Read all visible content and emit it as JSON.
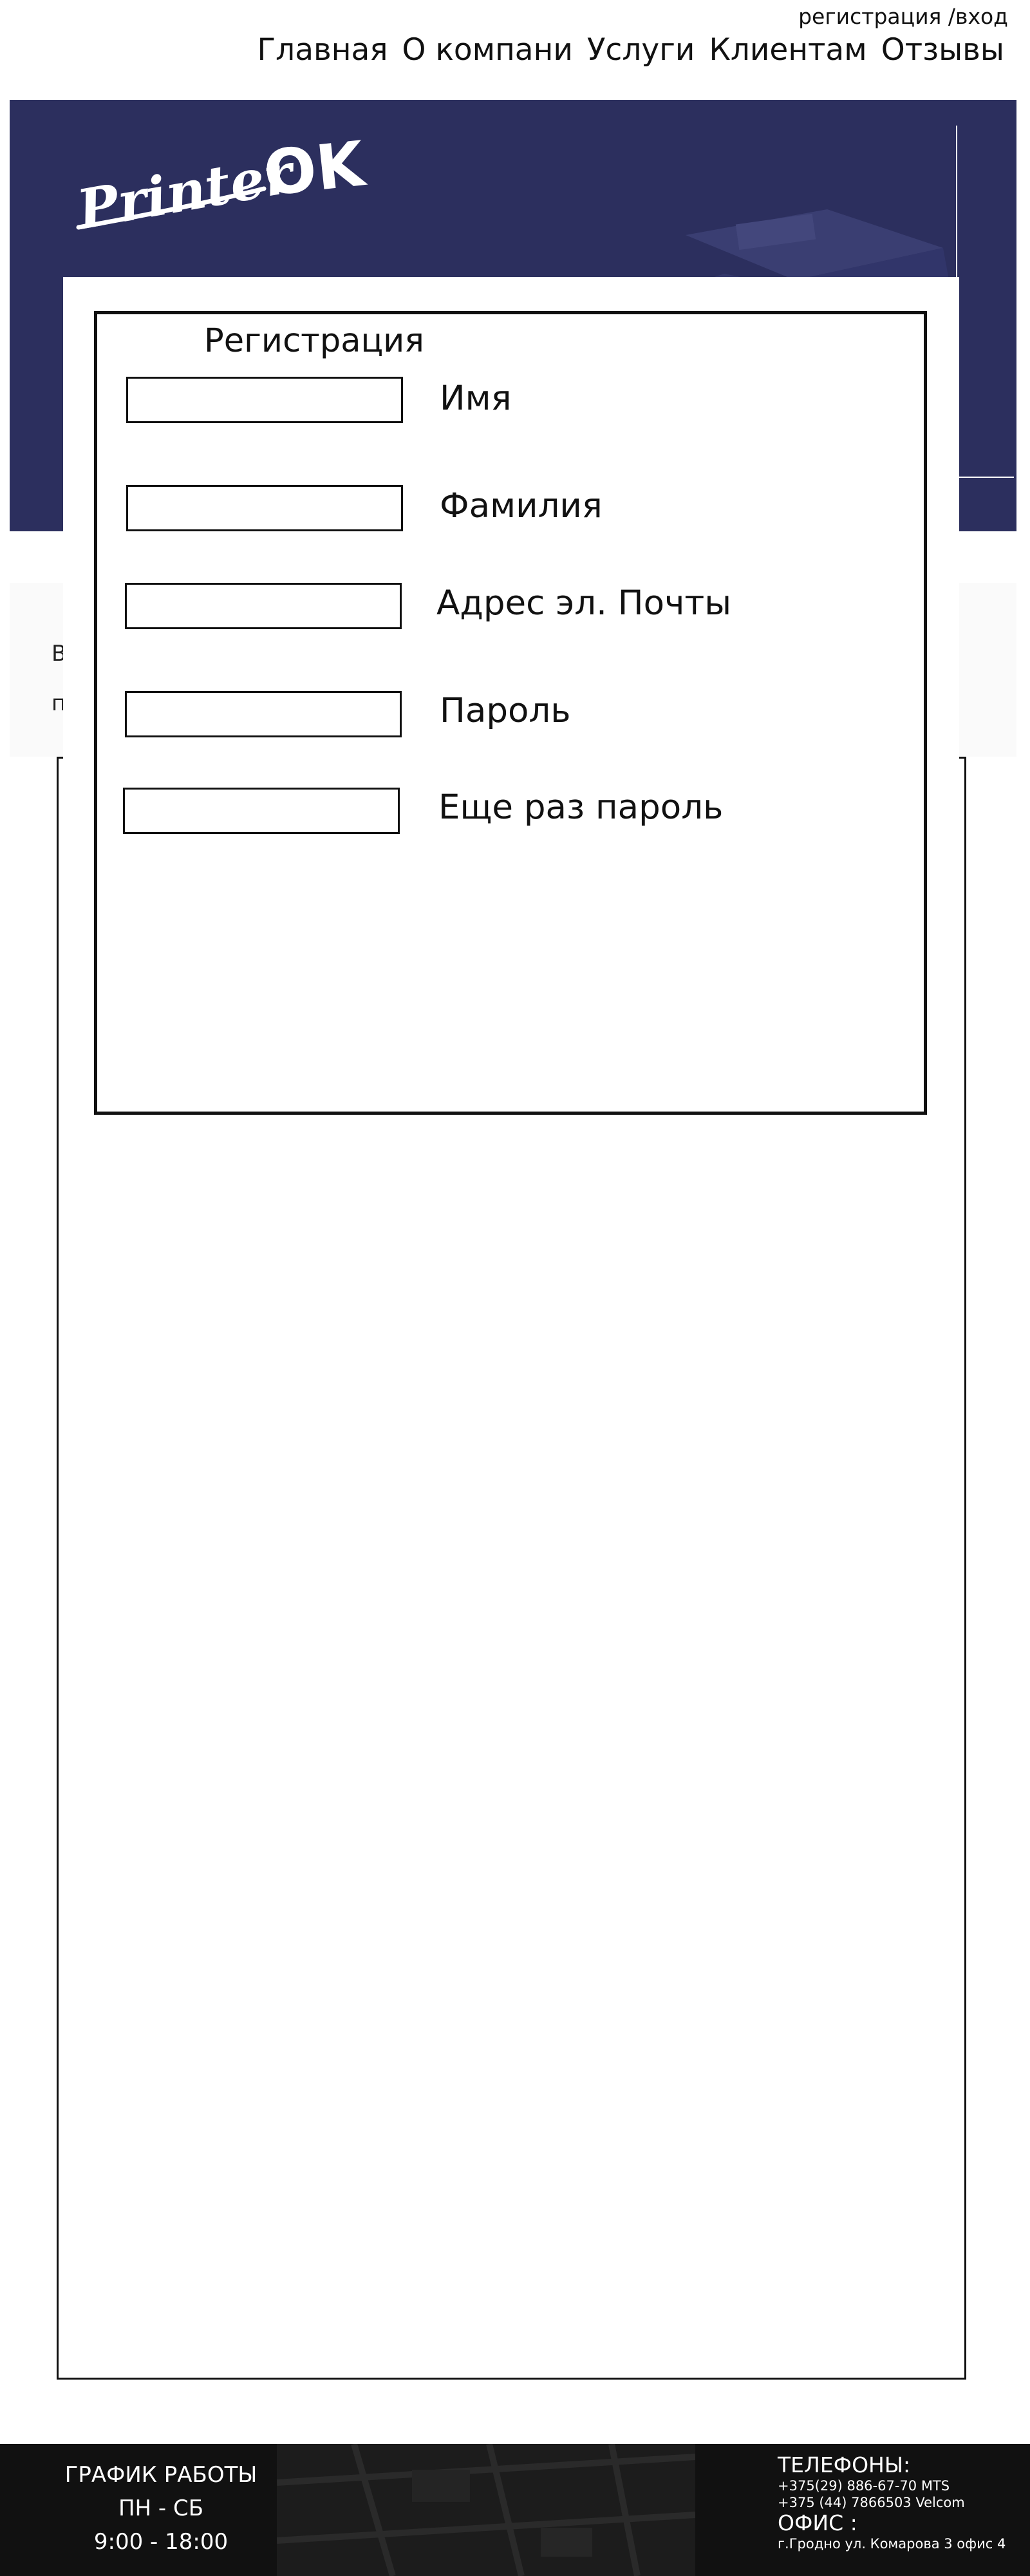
{
  "header": {
    "auth_link": "регистрация /вход",
    "nav": [
      "Главная",
      "О компани",
      "Услуги",
      "Клиентам",
      "Отзывы"
    ],
    "logo_text": "Printer",
    "logo_mark": "OK"
  },
  "content": {
    "stub_1": "В",
    "stub_2": "п"
  },
  "registration": {
    "title": "Регистрация",
    "fields": [
      {
        "label": "Имя",
        "value": ""
      },
      {
        "label": "Фамилия",
        "value": ""
      },
      {
        "label": "Адрес эл. Почты",
        "value": ""
      },
      {
        "label": "Пароль",
        "value": ""
      },
      {
        "label": "Еще раз пароль",
        "value": ""
      }
    ]
  },
  "footer": {
    "schedule_title": "ГРАФИК РАБОТЫ",
    "schedule_days": "ПН - СБ",
    "schedule_hours": "9:00 - 18:00",
    "phones_title": "ТЕЛЕФОНЫ:",
    "phone_1": "+375(29) 886-67-70 MTS",
    "phone_2": "+375 (44) 7866503  Velcom",
    "office_title": "ОФИС :",
    "office_address": "г.Гродно ул. Комарова 3 офис 4"
  },
  "colors": {
    "banner": "#2c2f5e",
    "footer": "#111111"
  }
}
